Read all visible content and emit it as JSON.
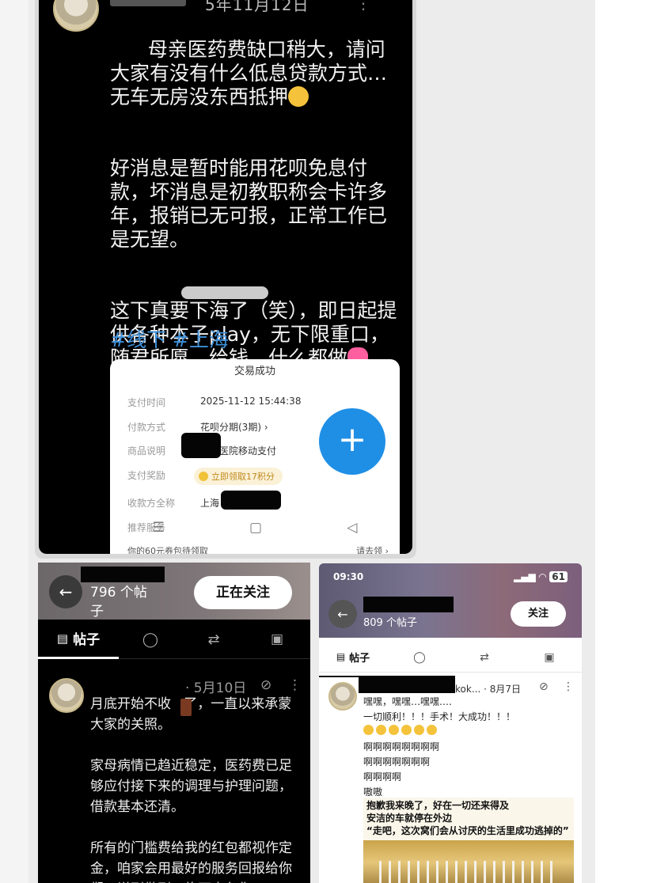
{
  "top_post": {
    "date_fragment": "5年11月12日",
    "paragraph_1": "母亲医药费缺口稍大，请问大家有没有什么低息贷款方式…无车无房没东西抵押",
    "paragraph_2": "好消息是暂时能用花呗免息付款，坏消息是初教职称会卡许多年，报销已无可报，正常工作已是无望。",
    "paragraph_3a": "这下真要下海了（笑），即日起提供各种本子play，无下限重口，",
    "paragraph_3b": "随君所愿，给钱，什么都做",
    "tags": "#线下 #上海",
    "receipt": {
      "title": "交易成功",
      "rows": [
        {
          "label": "支付时间",
          "value": "2025-11-12 15:44:38"
        },
        {
          "label": "付款方式",
          "value": "花呗分期(3期) ›"
        },
        {
          "label": "商品说明",
          "value": "医院移动支付"
        },
        {
          "label": "支付奖励",
          "value": ""
        },
        {
          "label": "收款方全称",
          "value": "上海              医院"
        },
        {
          "label": "推荐服务",
          "value": ""
        }
      ],
      "reward": "立即领取17积分",
      "footer_left": "你的60元券包待领取",
      "footer_right": "请去领 ›"
    }
  },
  "left_profile": {
    "post_count": "796 个帖子",
    "follow_button": "正在关注",
    "tab_posts": "帖子",
    "post_date": "· 5月10日",
    "post_text": "月底开始不收   了，一直以来承蒙大家的关照。\n\n家母病情已趋近稳定，医药费已足够应付接下来的调理与护理问题，借款基本还清。\n\n所有的门槛费给我的红包都视作定金，咱家会用最好的服务回报给你们，说到做到，绝不毒色你"
  },
  "right_profile": {
    "time": "09:30",
    "battery": "61",
    "post_count": "809 个帖子",
    "follow_button": "关注",
    "tab_posts": "帖子",
    "handle": "kok... · 8月7日",
    "post_text": "嘿嘿，嘿嘿…嘿嘿….\n一切顺利！！！手术！大成功！！！\n\n啊啊啊啊啊啊啊啊\n啊啊啊啊啊啊啊\n啊啊啊啊\n嗷嗷",
    "image_caption": "抱歉我来晚了，好在一切还来得及\n安洁的车就停在外边\n“走吧，这次窝们会从讨厌的生活里成功逃掉的”"
  },
  "colors": {
    "accent_blue": "#1f8fe6",
    "tag_blue": "#3d8fd8",
    "reward_gold": "#c08a1e"
  }
}
